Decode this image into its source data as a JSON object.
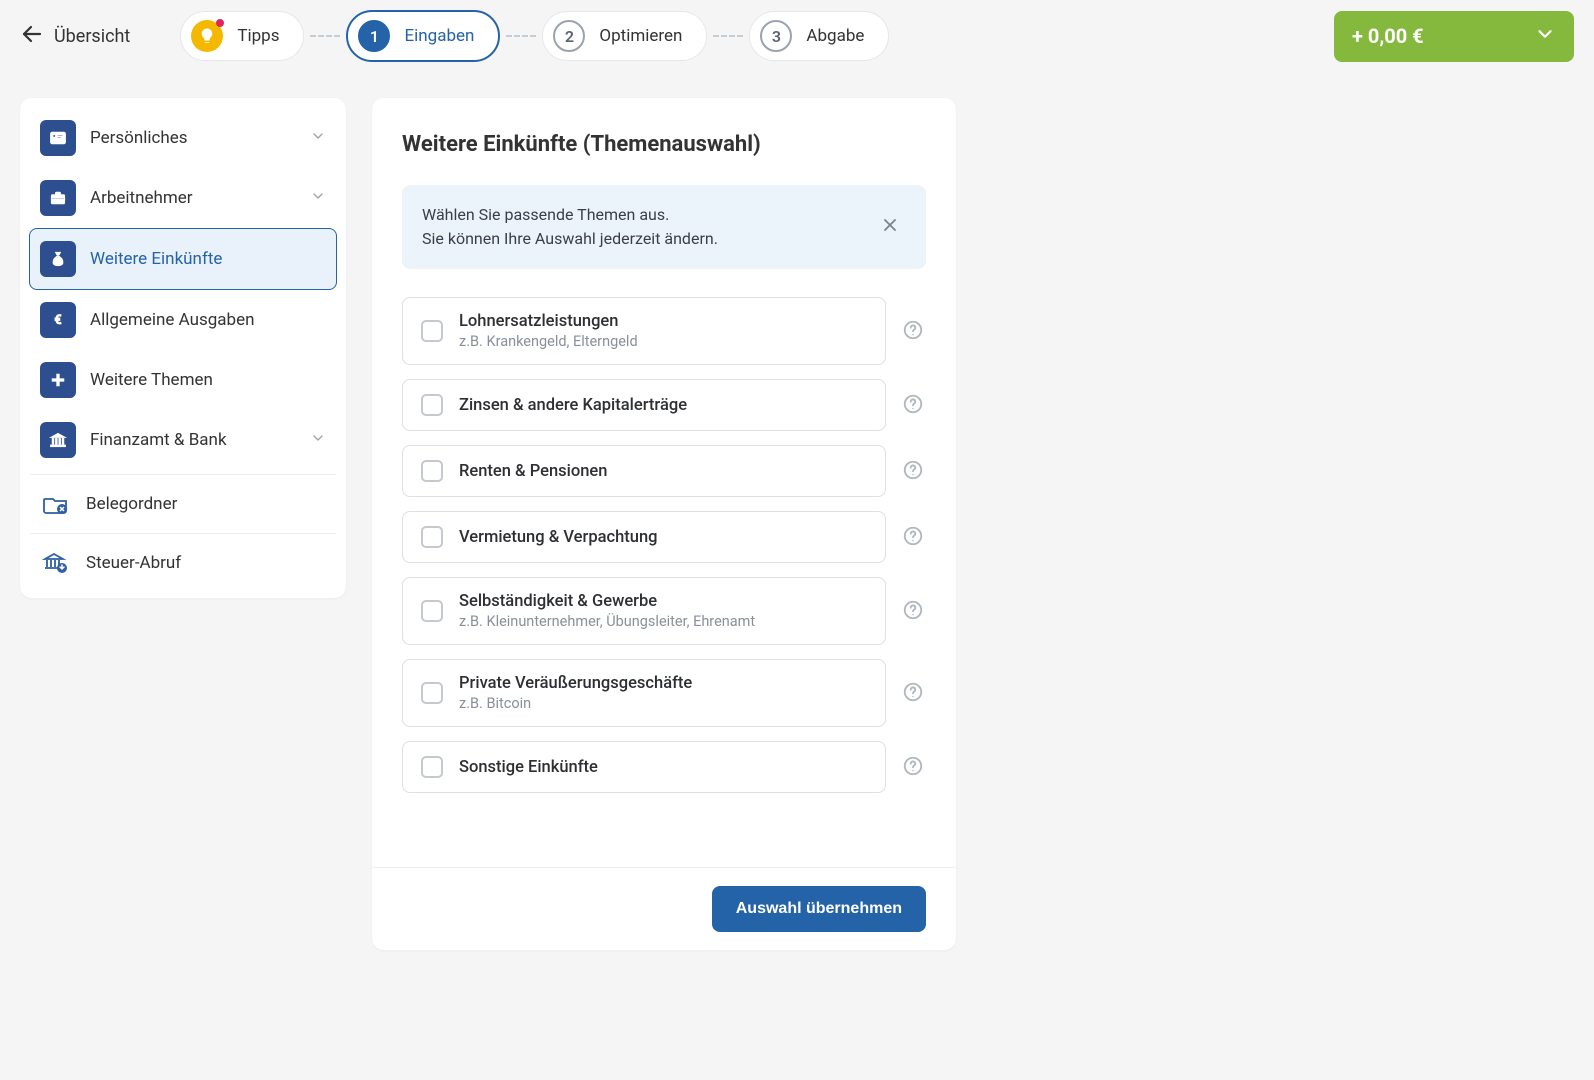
{
  "header": {
    "back_label": "Übersicht",
    "tips_label": "Tipps",
    "steps": [
      {
        "num": "1",
        "label": "Eingaben",
        "active": true
      },
      {
        "num": "2",
        "label": "Optimieren",
        "active": false
      },
      {
        "num": "3",
        "label": "Abgabe",
        "active": false
      }
    ],
    "amount": "+ 0,00 €"
  },
  "sidebar": {
    "items": [
      {
        "label": "Persönliches",
        "expandable": true,
        "active": false
      },
      {
        "label": "Arbeitnehmer",
        "expandable": true,
        "active": false
      },
      {
        "label": "Weitere Einkünfte",
        "expandable": false,
        "active": true
      },
      {
        "label": "Allgemeine Ausgaben",
        "expandable": false,
        "active": false
      },
      {
        "label": "Weitere Themen",
        "expandable": false,
        "active": false
      },
      {
        "label": "Finanzamt & Bank",
        "expandable": true,
        "active": false
      }
    ],
    "secondary": [
      {
        "label": "Belegordner"
      },
      {
        "label": "Steuer-Abruf"
      }
    ]
  },
  "main": {
    "title": "Weitere Einkünfte (Themenauswahl)",
    "info_line1": "Wählen Sie passende Themen aus.",
    "info_line2": "Sie können Ihre Auswahl jederzeit ändern.",
    "topics": [
      {
        "title": "Lohnersatzleistungen",
        "sub": "z.B. Krankengeld, Elterngeld"
      },
      {
        "title": "Zinsen & andere Kapitalerträge",
        "sub": ""
      },
      {
        "title": "Renten & Pensionen",
        "sub": ""
      },
      {
        "title": "Vermietung & Verpachtung",
        "sub": ""
      },
      {
        "title": "Selbständigkeit & Gewerbe",
        "sub": "z.B. Kleinunternehmer, Übungsleiter, Ehrenamt"
      },
      {
        "title": "Private Veräußerungsgeschäfte",
        "sub": "z.B. Bitcoin"
      },
      {
        "title": "Sonstige Einkünfte",
        "sub": ""
      }
    ],
    "submit_label": "Auswahl übernehmen"
  }
}
